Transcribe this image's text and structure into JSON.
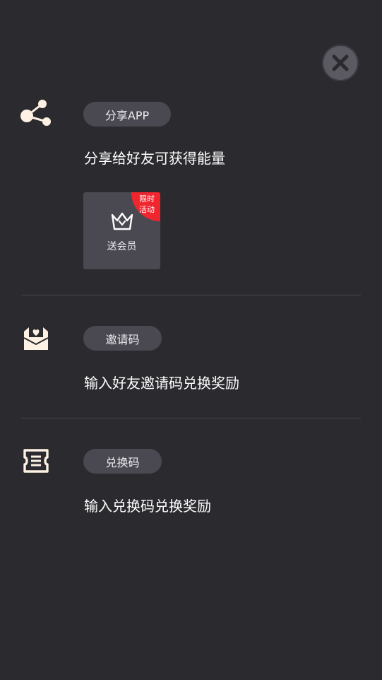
{
  "colors": {
    "background": "#2b2a2f",
    "pill": "#4a4952",
    "icon": "#fdf1e3",
    "badge": "#f0262f",
    "close_button": "#5b5a63"
  },
  "close": {
    "icon": "close-icon"
  },
  "share": {
    "icon": "share-icon",
    "pill_label": "分享APP",
    "description": "分享给好友可获得能量",
    "reward": {
      "icon": "crown-icon",
      "label": "送会员",
      "badge_line1": "限时",
      "badge_line2": "活动"
    }
  },
  "invite": {
    "icon": "mail-heart-icon",
    "pill_label": "邀请码",
    "description": "输入好友邀请码兑换奖励"
  },
  "redeem": {
    "icon": "ticket-icon",
    "pill_label": "兑换码",
    "description": "输入兑换码兑换奖励"
  }
}
